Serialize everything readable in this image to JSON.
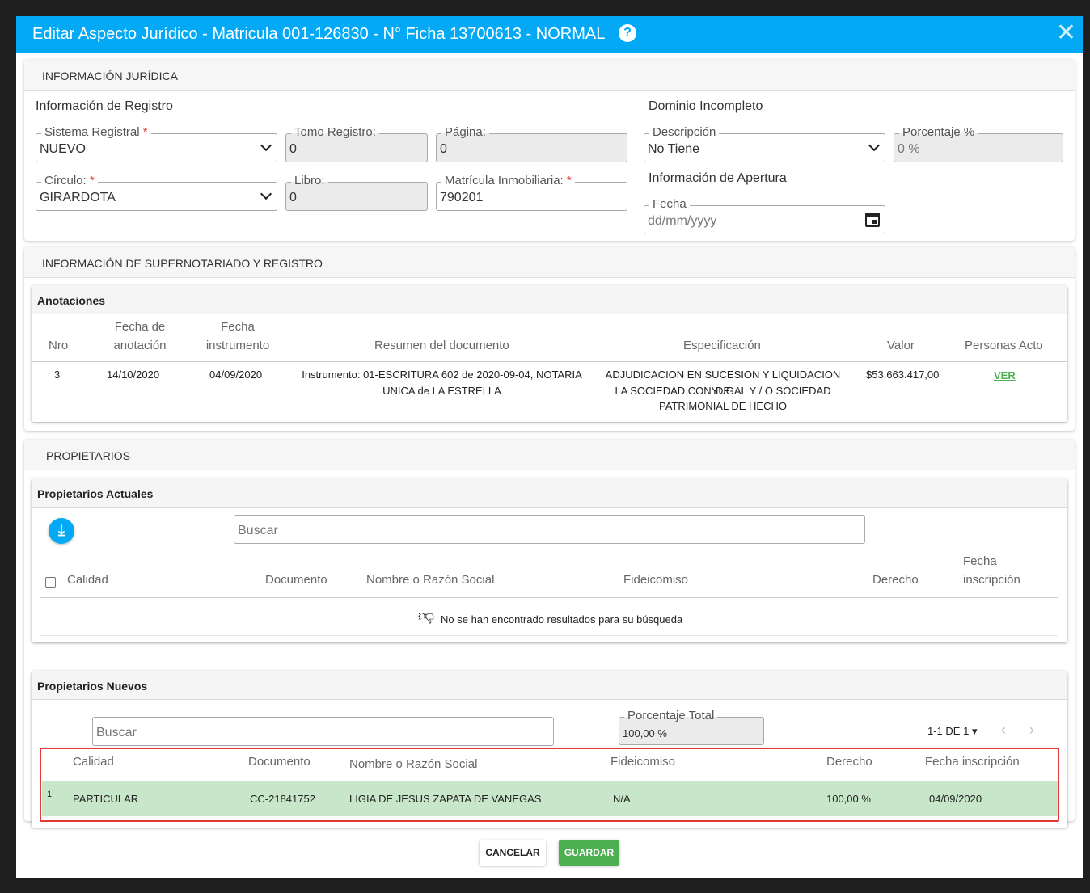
{
  "header": {
    "title": "Editar Aspecto Jurídico - Matricula 001-126830 - N° Ficha 13700613 - NORMAL",
    "help": "?",
    "close": "✕"
  },
  "juridica": {
    "section_title": "INFORMACIÓN JURÍDICA",
    "registro_title": "Información de Registro",
    "sistema_label": "Sistema Registral",
    "sistema_value": "NUEVO",
    "tomo_label": "Tomo Registro:",
    "tomo_value": "0",
    "pagina_label": "Página:",
    "pagina_value": "0",
    "circulo_label": "Círculo:",
    "circulo_value": "GIRARDOTA",
    "libro_label": "Libro:",
    "libro_value": "0",
    "matricula_label": "Matrícula Inmobiliaria:",
    "matricula_value": "790201",
    "required_mark": "*",
    "dominio_title": "Dominio Incompleto",
    "descripcion_label": "Descripción",
    "descripcion_value": "No Tiene",
    "porcentaje_label": "Porcentaje %",
    "porcentaje_value": "0 %",
    "apertura_title": "Información de Apertura",
    "fecha_label": "Fecha",
    "fecha_placeholder": "dd/mm/yyyy"
  },
  "supernotariado": {
    "section_title": "INFORMACIÓN DE SUPERNOTARIADO Y REGISTRO",
    "anotaciones_title": "Anotaciones",
    "headers": {
      "nro": "Nro",
      "fecha_anotacion_1": "Fecha de",
      "fecha_anotacion_2": "anotación",
      "fecha_instrumento_1": "Fecha",
      "fecha_instrumento_2": "instrumento",
      "resumen": "Resumen del documento",
      "especificacion": "Especificación",
      "valor": "Valor",
      "personas": "Personas Acto"
    },
    "row": {
      "nro": "3",
      "fecha_anotacion": "14/10/2020",
      "fecha_instrumento": "04/09/2020",
      "resumen_1": "Instrumento: 01-ESCRITURA 602 de 2020-09-04, NOTARIA",
      "resumen_2": "UNICA de LA ESTRELLA",
      "especificacion_1": "ADJUDICACION EN SUCESION Y LIQUIDACION DE",
      "especificacion_2": "LA SOCIEDAD CONYUGAL Y / O SOCIEDAD",
      "especificacion_3": "PATRIMONIAL DE HECHO",
      "valor": "$53.663.417,00",
      "personas": "VER"
    }
  },
  "propietarios": {
    "section_title": "PROPIETARIOS",
    "actuales": {
      "title": "Propietarios Actuales",
      "search_placeholder": "Buscar",
      "headers": {
        "calidad": "Calidad",
        "documento": "Documento",
        "nombre": "Nombre o Razón Social",
        "fideicomiso": "Fideicomiso",
        "derecho": "Derecho",
        "fecha_1": "Fecha",
        "fecha_2": "inscripción"
      },
      "empty_message": "No se han encontrado resultados para su búsqueda"
    },
    "nuevos": {
      "title": "Propietarios Nuevos",
      "search_placeholder": "Buscar",
      "porcentaje_label": "Porcentaje Total",
      "porcentaje_value": "100,00 %",
      "pagination": "1-1 DE 1",
      "headers": {
        "calidad": "Calidad",
        "documento": "Documento",
        "nombre": "Nombre o Razón Social",
        "fideicomiso": "Fideicomiso",
        "derecho": "Derecho",
        "fecha": "Fecha inscripción"
      },
      "row": {
        "index": "1",
        "calidad": "PARTICULAR",
        "documento": "CC-21841752",
        "nombre": "LIGIA DE JESUS ZAPATA DE VANEGAS",
        "fideicomiso": "N/A",
        "derecho": "100,00 %",
        "fecha": "04/09/2020"
      }
    }
  },
  "footer": {
    "cancel": "CANCELAR",
    "save": "GUARDAR"
  },
  "colors": {
    "header": "#03a9f4",
    "highlight_row": "#c8e6c9",
    "highlight_border": "#e53935",
    "save": "#4caf50"
  }
}
